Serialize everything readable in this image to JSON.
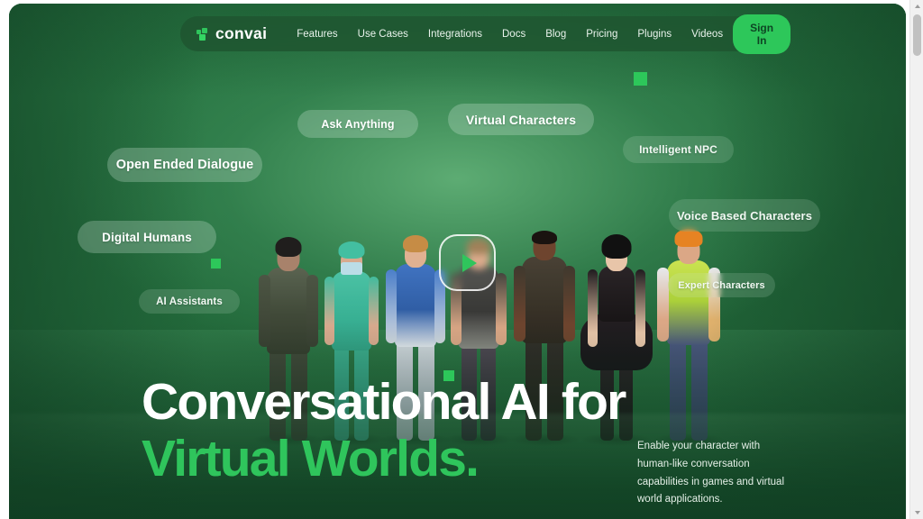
{
  "brand": {
    "name": "convai",
    "logo_icon": "convai-pixel-squares-icon",
    "accent_color": "#2dc75a",
    "background_color": "#236b3c",
    "headline_accent_color": "#2fc55c"
  },
  "navbar": {
    "links": [
      {
        "label": "Features"
      },
      {
        "label": "Use Cases"
      },
      {
        "label": "Integrations"
      },
      {
        "label": "Docs"
      },
      {
        "label": "Blog"
      },
      {
        "label": "Pricing"
      },
      {
        "label": "Plugins"
      },
      {
        "label": "Videos"
      }
    ],
    "cta": {
      "label": "Sign In"
    }
  },
  "hero": {
    "headline_line1": "Conversational AI for",
    "headline_line2": "Virtual Worlds.",
    "paragraph": "Enable your character with human-like conversation capabilities in games and virtual world applications.",
    "play_button": {
      "icon": "play-triangle-icon",
      "label": ""
    },
    "pills": [
      {
        "id": "ask-anything",
        "label": "Ask Anything"
      },
      {
        "id": "virtual-characters",
        "label": "Virtual Characters"
      },
      {
        "id": "open-ended-dialogue",
        "label": "Open Ended Dialogue"
      },
      {
        "id": "intelligent-npc",
        "label": "Intelligent NPC"
      },
      {
        "id": "digital-humans",
        "label": "Digital Humans"
      },
      {
        "id": "voice-based-characters",
        "label": "Voice Based Characters"
      },
      {
        "id": "ai-assistants",
        "label": "AI Assistants"
      },
      {
        "id": "expert-characters",
        "label": "Expert Characters"
      }
    ],
    "characters": [
      {
        "id": "armored-warrior",
        "skin": "#a9826a",
        "hair": "#22201f",
        "top": "#47503f",
        "bottom": "#3b4236"
      },
      {
        "id": "surgeon-nurse",
        "skin": "#d8a98c",
        "hair": "#3fbfa0",
        "top": "#36b394",
        "bottom": "#2fa687"
      },
      {
        "id": "sci-fi-blue-armor",
        "skin": "#e0b08f",
        "hair": "#c78b42",
        "top": "#2f5fa8",
        "bottom": "#d8dde3"
      },
      {
        "id": "dark-tactical-girl",
        "skin": "#d9a583",
        "hair": "#9b7a4e",
        "top": "#3a3a38",
        "bottom": "#2a2a2c"
      },
      {
        "id": "man-dark-shirt",
        "skin": "#70452e",
        "hair": "#1c1512",
        "top": "#3a3328",
        "bottom": "#2a2620"
      },
      {
        "id": "ninja-black-dress",
        "skin": "#e8c3a6",
        "hair": "#131313",
        "top": "#1a1718",
        "bottom": "#141314"
      },
      {
        "id": "construction-worker",
        "skin": "#dba684",
        "hair": "#e8821f",
        "top": "#b9d93c",
        "bottom": "#3f4e74"
      }
    ]
  },
  "scrollbar": {
    "up_icon": "caret-up-icon",
    "down_icon": "caret-down-icon"
  }
}
